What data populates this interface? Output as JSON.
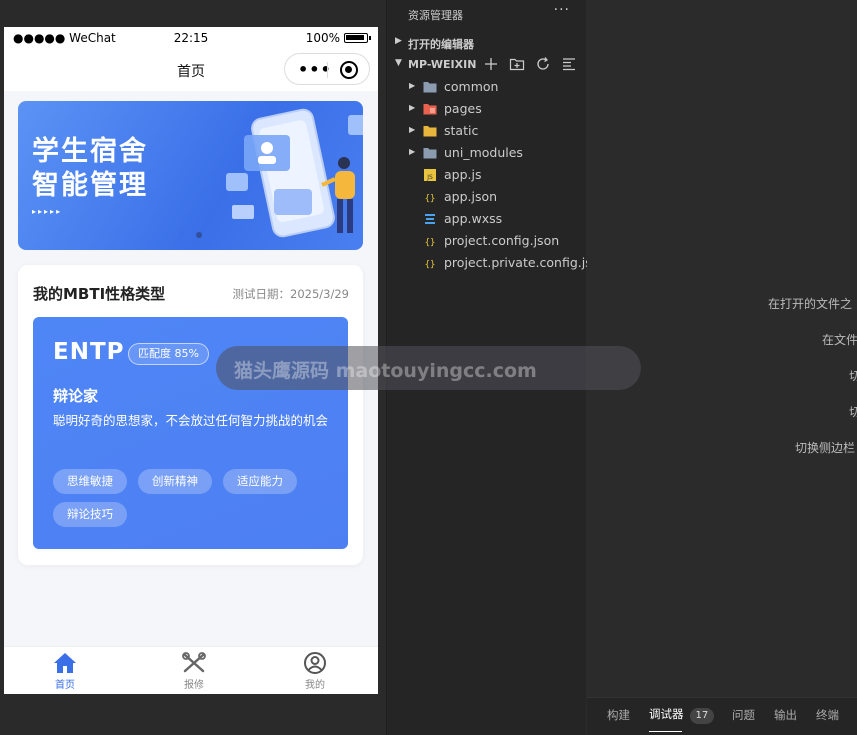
{
  "simulator": {
    "status_bar": {
      "carrier": "●●●●● WeChat",
      "time": "22:15",
      "battery_percent": "100%"
    },
    "nav": {
      "title": "首页"
    },
    "banner": {
      "line1": "学生宿舍",
      "line2": "智能管理",
      "arrows": "▸▸▸▸▸"
    },
    "mbti_card": {
      "title": "我的MBTI性格类型",
      "date": "测试日期：2025/3/29",
      "type": "ENTP",
      "match": "匹配度 85%",
      "name": "辩论家",
      "description": "聪明好奇的思想家，不会放过任何智力挑战的机会",
      "tags": [
        "思维敏捷",
        "创新精神",
        "适应能力",
        "辩论技巧"
      ]
    },
    "tab_bar": {
      "items": [
        {
          "label": "首页"
        },
        {
          "label": "报修"
        },
        {
          "label": "我的"
        }
      ]
    }
  },
  "explorer": {
    "title": "资源管理器",
    "more": "···",
    "open_editors": "打开的编辑器",
    "project": "MP-WEIXIN",
    "items": [
      {
        "name": "common",
        "kind": "folder",
        "color": "#8b9bb0"
      },
      {
        "name": "pages",
        "kind": "folder",
        "color": "#e8624f"
      },
      {
        "name": "static",
        "kind": "folder",
        "color": "#e8b63c"
      },
      {
        "name": "uni_modules",
        "kind": "folder",
        "color": "#8b9bb0"
      },
      {
        "name": "app.js",
        "kind": "js",
        "color": "#e8c53c"
      },
      {
        "name": "app.json",
        "kind": "json",
        "color": "#e8c53c"
      },
      {
        "name": "app.wxss",
        "kind": "css",
        "color": "#4aa3f0"
      },
      {
        "name": "project.config.json",
        "kind": "json",
        "color": "#e8c53c"
      },
      {
        "name": "project.private.config.js...",
        "kind": "json",
        "color": "#e8c53c"
      }
    ]
  },
  "editor": {
    "hints": [
      "在打开的文件之",
      "在文件",
      "切",
      "切",
      "切换侧边栏"
    ]
  },
  "panel": {
    "tabs": [
      {
        "label": "构建"
      },
      {
        "label": "调试器",
        "badge": "17"
      },
      {
        "label": "问题"
      },
      {
        "label": "输出"
      },
      {
        "label": "终端"
      }
    ]
  },
  "watermark": {
    "text": "猫头鹰源码 maotouyingcc.com"
  }
}
